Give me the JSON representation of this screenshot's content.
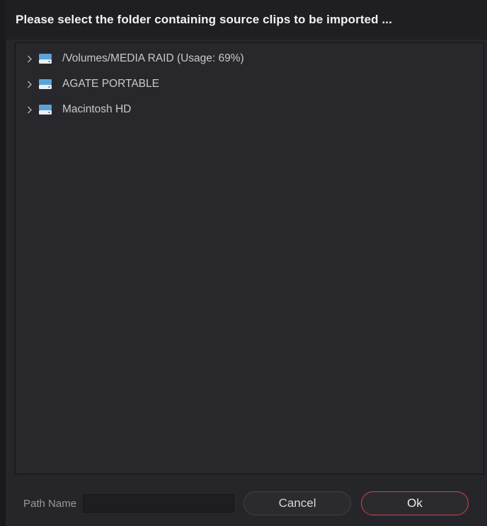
{
  "dialog": {
    "title": "Please select the folder containing source clips to be imported ..."
  },
  "tree": {
    "items": [
      {
        "label": "/Volumes/MEDIA RAID (Usage: 69%)",
        "icon": "hard-drive-icon",
        "expander": "chevron-right-icon"
      },
      {
        "label": "AGATE PORTABLE",
        "icon": "hard-drive-icon",
        "expander": "chevron-right-icon"
      },
      {
        "label": "Macintosh HD",
        "icon": "hard-drive-icon",
        "expander": "chevron-right-icon"
      }
    ]
  },
  "footer": {
    "path_label": "Path Name",
    "path_value": "",
    "cancel_label": "Cancel",
    "ok_label": "Ok"
  },
  "colors": {
    "accent_ok_border": "#d8414a",
    "drive_icon": "#5aa3d8",
    "background": "#26262a"
  }
}
